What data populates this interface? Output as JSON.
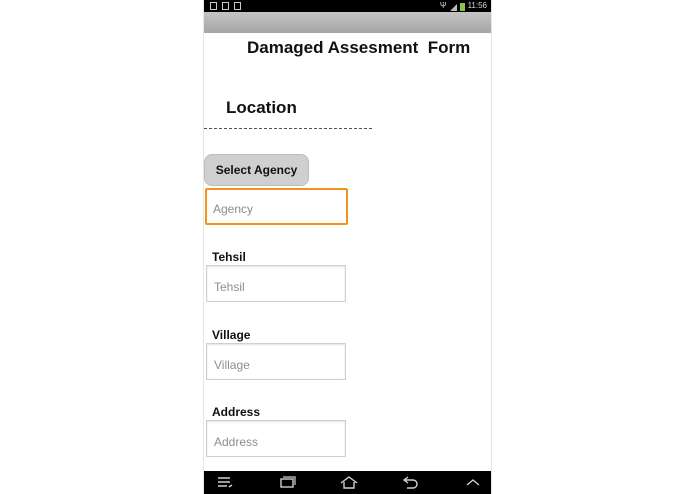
{
  "status_bar": {
    "time": "11:56",
    "left_icons": [
      "document-icon",
      "image-icon",
      "mail-icon"
    ],
    "right_icons": [
      "usb-icon",
      "signal-icon",
      "battery-icon"
    ]
  },
  "form": {
    "title": "Damaged Assesment  Form",
    "section_title": "Location",
    "select_agency_label": "Select Agency",
    "agency": {
      "value": "",
      "placeholder": "Agency"
    },
    "tehsil": {
      "label": "Tehsil",
      "value": "",
      "placeholder": "Tehsil"
    },
    "village": {
      "label": "Village",
      "value": "",
      "placeholder": "Village"
    },
    "address": {
      "label": "Address",
      "value": "",
      "placeholder": "Address"
    }
  },
  "nav_bar": {
    "items": [
      "menu-icon",
      "recent-apps-icon",
      "home-icon",
      "back-icon",
      "chevron-up-icon"
    ]
  },
  "colors": {
    "focus_border": "#f0941e",
    "action_bar": "#b3b3b3",
    "button_bg": "#cfcfcf",
    "nav_bg": "#000000"
  }
}
